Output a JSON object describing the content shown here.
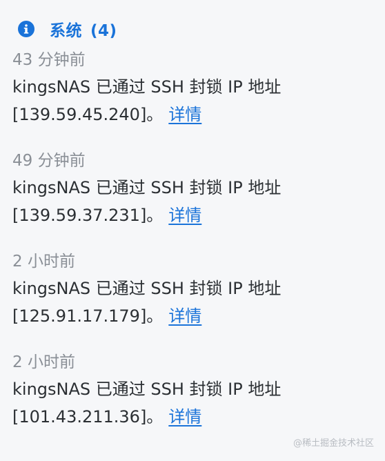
{
  "header": {
    "icon": "info-icon",
    "accent_color": "#1a73d9",
    "title": "系统",
    "count": "(4)"
  },
  "notifications": [
    {
      "time": "43 分钟前",
      "message_line1": "kingsNAS 已通过 SSH 封锁 IP 地址",
      "message_line2": "[139.59.45.240]。",
      "link_label": "详情"
    },
    {
      "time": "49 分钟前",
      "message_line1": "kingsNAS 已通过 SSH 封锁 IP 地址",
      "message_line2": "[139.59.37.231]。",
      "link_label": "详情"
    },
    {
      "time": "2 小时前",
      "message_line1": "kingsNAS 已通过 SSH 封锁 IP 地址",
      "message_line2": "[125.91.17.179]。",
      "link_label": "详情"
    },
    {
      "time": "2 小时前",
      "message_line1": "kingsNAS 已通过 SSH 封锁 IP 地址",
      "message_line2": "[101.43.211.36]。",
      "link_label": "详情"
    }
  ],
  "watermark": "@稀土掘金技术社区"
}
